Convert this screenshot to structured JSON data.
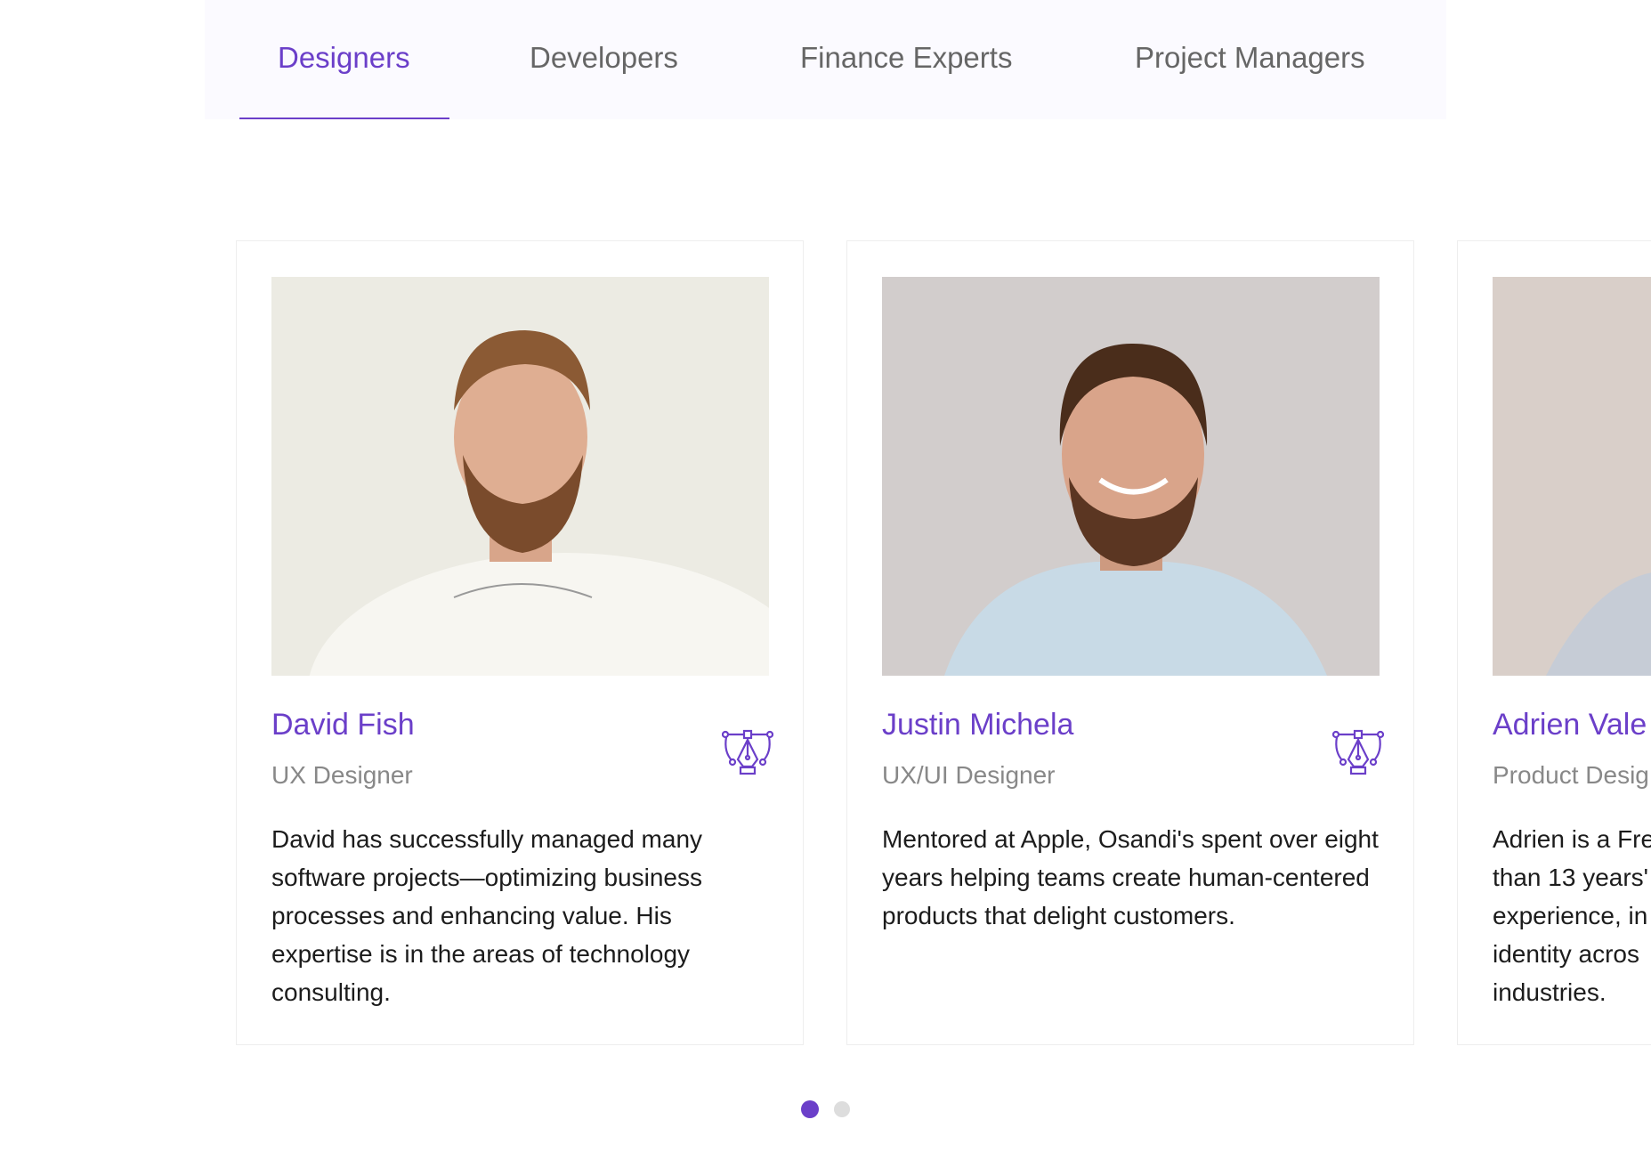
{
  "tabs": [
    {
      "label": "Designers",
      "active": true
    },
    {
      "label": "Developers",
      "active": false
    },
    {
      "label": "Finance Experts",
      "active": false
    },
    {
      "label": "Project Managers",
      "active": false
    }
  ],
  "cards": [
    {
      "name": "David Fish",
      "role": "UX Designer",
      "bio": "David has successfully managed many software projects—optimizing business processes and enhancing value. His expertise is in the areas of technology consulting.",
      "role_icon": "pen-tool-icon",
      "photo": "portrait-photo"
    },
    {
      "name": "Justin Michela",
      "role": "UX/UI Designer",
      "bio": "Mentored at Apple, Osandi's spent over eight years helping teams create human-centered products that delight customers.",
      "role_icon": "pen-tool-icon",
      "photo": "portrait-photo"
    },
    {
      "name": "Adrien Vale",
      "role": "Product Desig",
      "bio": "Adrien is a Fre than 13 years' experience, in identity acros industries.",
      "role_icon": "pen-tool-icon",
      "photo": "portrait-photo"
    }
  ],
  "pagination": {
    "total": 2,
    "active": 1
  },
  "colors": {
    "accent": "#6b3fc9",
    "tab_bg": "#fbfaff",
    "text": "#1c1c1c",
    "muted": "#888888"
  }
}
